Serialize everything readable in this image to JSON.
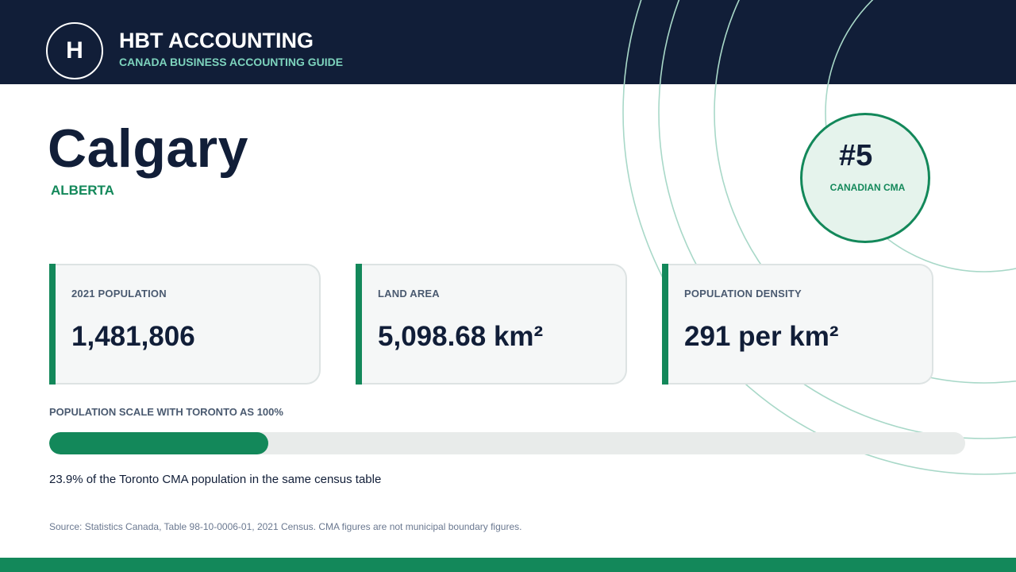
{
  "header": {
    "logo_letter": "H",
    "brand_name": "HBT ACCOUNTING",
    "tagline": "CANADA BUSINESS ACCOUNTING GUIDE"
  },
  "city": {
    "name": "Calgary",
    "province": "ALBERTA"
  },
  "rank": {
    "value": "#5",
    "label": "CANADIAN CMA"
  },
  "stats": [
    {
      "label": "2021 POPULATION",
      "value": "1,481,806"
    },
    {
      "label": "LAND AREA",
      "value": "5,098.68 km²"
    },
    {
      "label": "POPULATION DENSITY",
      "value": "291 per km²"
    }
  ],
  "scale": {
    "title": "POPULATION SCALE WITH TORONTO AS 100%",
    "percent": 23.9,
    "caption": "23.9% of the Toronto CMA population in the same census table"
  },
  "source": "Source: Statistics Canada, Table 98-10-0006-01, 2021 Census. CMA figures are not municipal boundary figures.",
  "colors": {
    "navy": "#111e38",
    "green": "#13885a",
    "mint": "#7dd3bd",
    "ring": "#a8d8c8"
  }
}
